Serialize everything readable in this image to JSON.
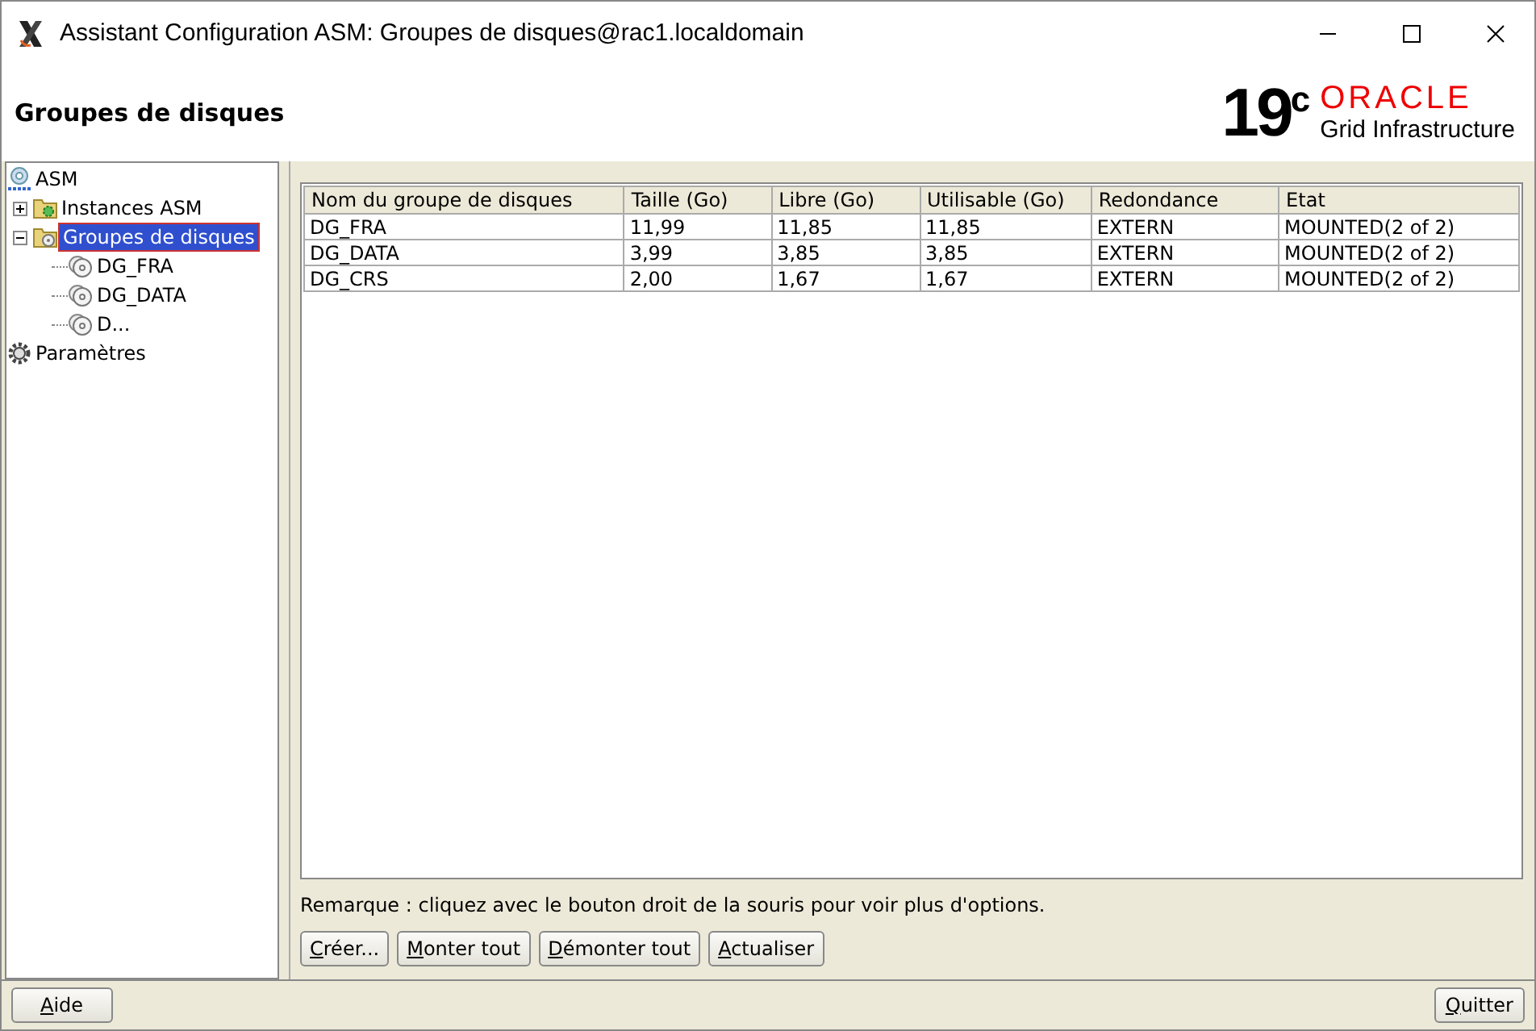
{
  "window": {
    "title": "Assistant Configuration ASM: Groupes de disques@rac1.localdomain"
  },
  "header": {
    "title": "Groupes de disques",
    "logo": {
      "version": "19$^{c}$",
      "brand": "ORACLE",
      "product": "Grid Infrastructure"
    }
  },
  "tree": [
    {
      "label": "ASM",
      "kind": "root",
      "selected": false,
      "children": [
        {
          "label": "Instances ASM",
          "kind": "instances",
          "selected": false,
          "expanded": false
        },
        {
          "label": "Groupes de disques",
          "kind": "groups",
          "selected": true,
          "expanded": true,
          "children": [
            {
              "label": "DG_FRA",
              "kind": "group",
              "selected": false
            },
            {
              "label": "DG_DATA",
              "kind": "group",
              "selected": false
            },
            {
              "label": "D...",
              "kind": "group",
              "selected": false
            }
          ]
        }
      ]
    },
    {
      "label": "Paramètres",
      "kind": "settings",
      "selected": false
    }
  ],
  "table": {
    "columns": [
      "Nom du groupe de disques",
      "Taille (Go)",
      "Libre (Go)",
      "Utilisable (Go)",
      "Redondance",
      "Etat"
    ],
    "rows": [
      [
        "DG_FRA",
        "11,99",
        "11,85",
        "11,85",
        "EXTERN",
        "MOUNTED(2 of 2)"
      ],
      [
        "DG_DATA",
        "3,99",
        "3,85",
        "3,85",
        "EXTERN",
        "MOUNTED(2 of 2)"
      ],
      [
        "DG_CRS",
        "2,00",
        "1,67",
        "1,67",
        "EXTERN",
        "MOUNTED(2 of 2)"
      ]
    ]
  },
  "note": "Remarque : cliquez avec le bouton droit de la souris pour voir plus d'options.",
  "buttons": [
    {
      "label": "Créer..."
    },
    {
      "label": "Monter tout"
    },
    {
      "label": "Démonter tout"
    },
    {
      "label": "Actualiser"
    }
  ],
  "footer_buttons": [
    {
      "label": "Aide"
    },
    {
      "label": "Quitter"
    }
  ]
}
